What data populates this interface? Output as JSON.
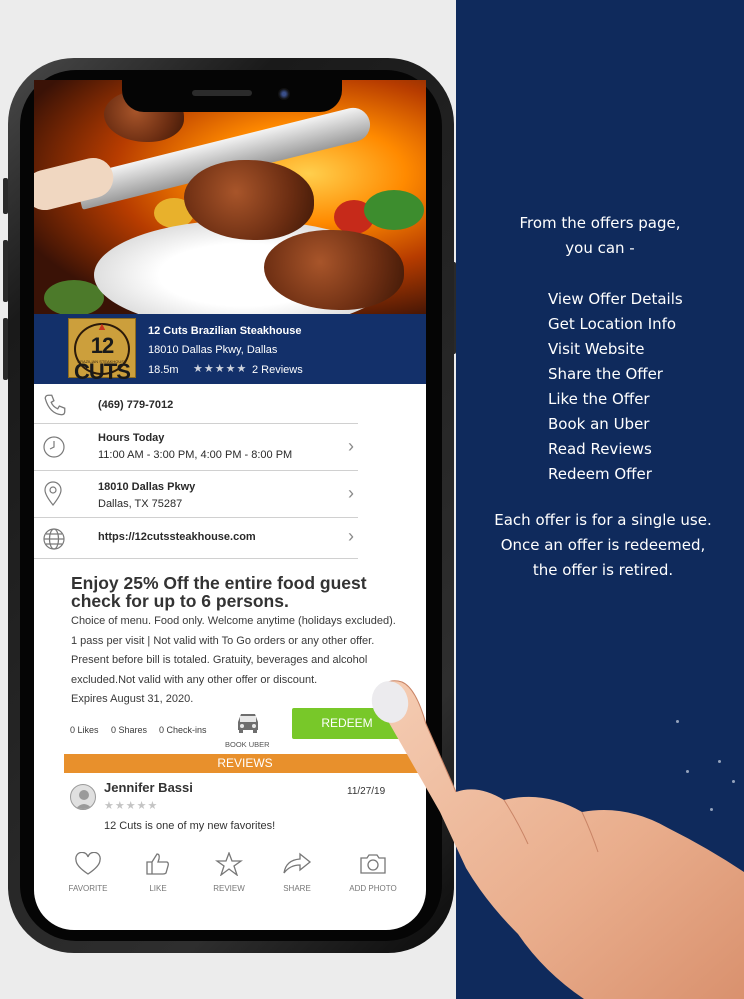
{
  "side_panel": {
    "intro": [
      "From the offers page,",
      "you can -"
    ],
    "features": [
      "View Offer Details",
      "Get Location Info",
      "Visit Website",
      "Share the Offer",
      "Like the Offer",
      "Book an Uber",
      "Read Reviews",
      "Redeem Offer"
    ],
    "outro": [
      "Each offer is for a single use.",
      "Once an offer is redeemed,",
      "the offer is retired."
    ]
  },
  "business": {
    "logo_text": "12 CUTS",
    "logo_sub": "BRAZILIAN STEAKHOUSE",
    "name": "12 Cuts Brazilian Steakhouse",
    "address": "18010 Dallas Pkwy, Dallas",
    "distance": "18.5m",
    "stars": "★★★★★",
    "reviews": "2 Reviews"
  },
  "details": {
    "phone": "(469) 779-7012",
    "hours_label": "Hours Today",
    "hours": "11:00 AM - 3:00 PM, 4:00 PM - 8:00 PM",
    "street": "18010 Dallas Pkwy",
    "city": "Dallas, TX 75287",
    "website": "https://12cutssteakhouse.com"
  },
  "offer": {
    "title": "Enjoy 25% Off the entire food guest check for up to 6 persons.",
    "body": "Choice of menu. Food only. Welcome anytime (holidays excluded). 1 pass per visit | Not valid with To Go orders or any other offer. Present before bill is totaled. Gratuity, beverages and alcohol excluded.Not valid with any other offer or discount.",
    "expires": "Expires August 31, 2020."
  },
  "stats": {
    "likes": "0 Likes",
    "shares": "0 Shares",
    "checkins": "0 Check-ins",
    "book_uber": "BOOK UBER",
    "redeem": "REDEEM"
  },
  "reviews": {
    "header": "REVIEWS",
    "items": [
      {
        "name": "Jennifer Bassi",
        "stars": "★★★★★",
        "date": "11/27/19",
        "text": "12 Cuts is one of my new favorites!"
      }
    ]
  },
  "tabs": [
    "FAVORITE",
    "LIKE",
    "REVIEW",
    "SHARE",
    "ADD PHOTO"
  ],
  "colors": {
    "navy": "#0f2a5c",
    "info_bar": "#13306a",
    "redeem_green": "#78c829",
    "reviews_orange": "#e8902c"
  }
}
